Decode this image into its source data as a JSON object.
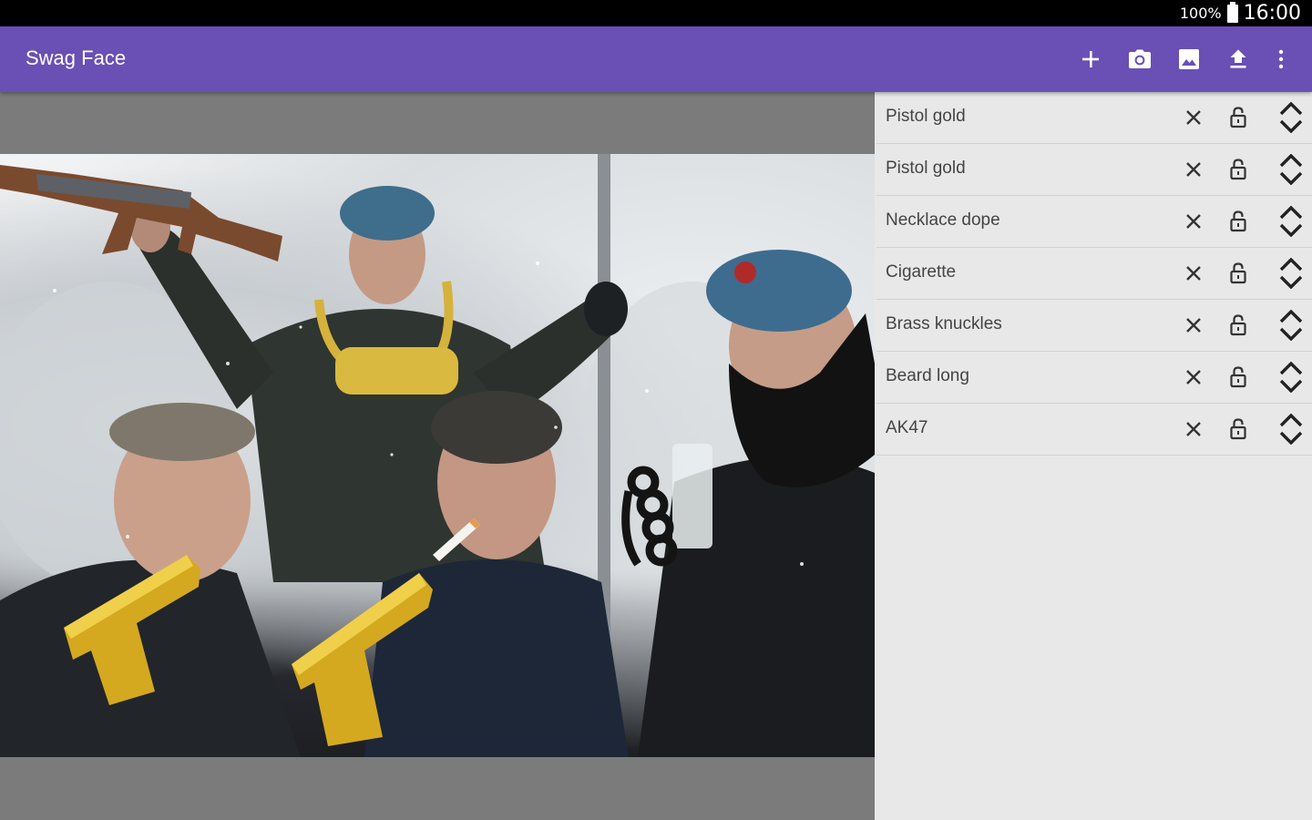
{
  "status_bar": {
    "battery": "100%",
    "time": "16:00"
  },
  "app_bar": {
    "title": "Swag Face",
    "actions": [
      "add-icon",
      "camera-icon",
      "image-icon",
      "upload-icon",
      "more-vert-icon"
    ]
  },
  "layers": [
    {
      "label": "Pistol gold"
    },
    {
      "label": "Pistol gold"
    },
    {
      "label": "Necklace dope"
    },
    {
      "label": "Cigarette"
    },
    {
      "label": "Brass knuckles"
    },
    {
      "label": "Beard long"
    },
    {
      "label": "AK47"
    }
  ],
  "colors": {
    "app_bar": "#6a4fb5",
    "canvas_bg": "#7b7b7b",
    "panel_bg": "#e8e8e8"
  }
}
